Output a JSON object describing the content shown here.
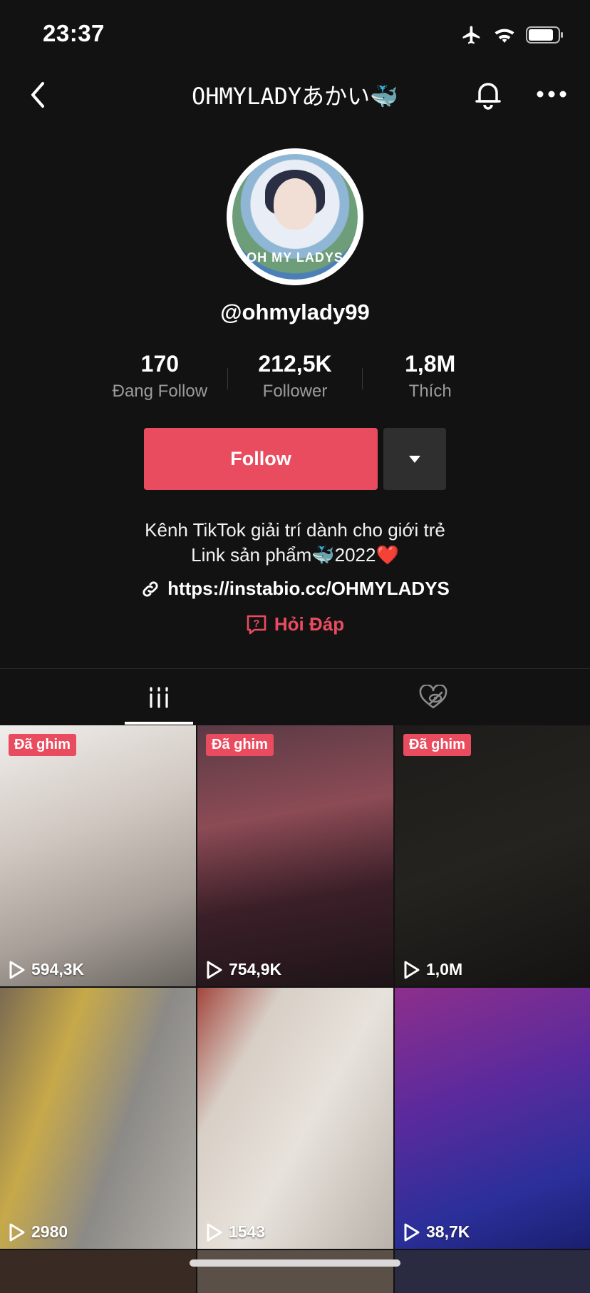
{
  "status_bar": {
    "time": "23:37"
  },
  "header": {
    "title": "OHMYLADYあかい🐳"
  },
  "profile": {
    "avatar_text": "OH MY LADYS",
    "username": "@ohmylady99",
    "stats": [
      {
        "value": "170",
        "label": "Đang Follow"
      },
      {
        "value": "212,5K",
        "label": "Follower"
      },
      {
        "value": "1,8M",
        "label": "Thích"
      }
    ],
    "follow_label": "Follow",
    "bio_line1": "Kênh TikTok giải trí dành cho giới trẻ",
    "bio_line2": "Link sản phẩm🐳2022❤️",
    "link": "https://instabio.cc/OHMYLADYS",
    "qa_label": "Hỏi Đáp"
  },
  "videos": [
    {
      "pinned_label": "Đã ghim",
      "views": "594,3K",
      "tint": "#cfcac6"
    },
    {
      "pinned_label": "Đã ghim",
      "views": "754,9K",
      "tint": "#6d3a3f"
    },
    {
      "pinned_label": "Đã ghim",
      "views": "1,0M",
      "tint": "#1a1918"
    },
    {
      "pinned_label": "",
      "views": "2980",
      "tint": "#8a7a47"
    },
    {
      "pinned_label": "",
      "views": "1543",
      "tint": "#bdb4ab"
    },
    {
      "pinned_label": "",
      "views": "38,7K",
      "tint": "#5a2a8a"
    }
  ],
  "colors": {
    "accent": "#ea4c5f",
    "background": "#121212"
  }
}
